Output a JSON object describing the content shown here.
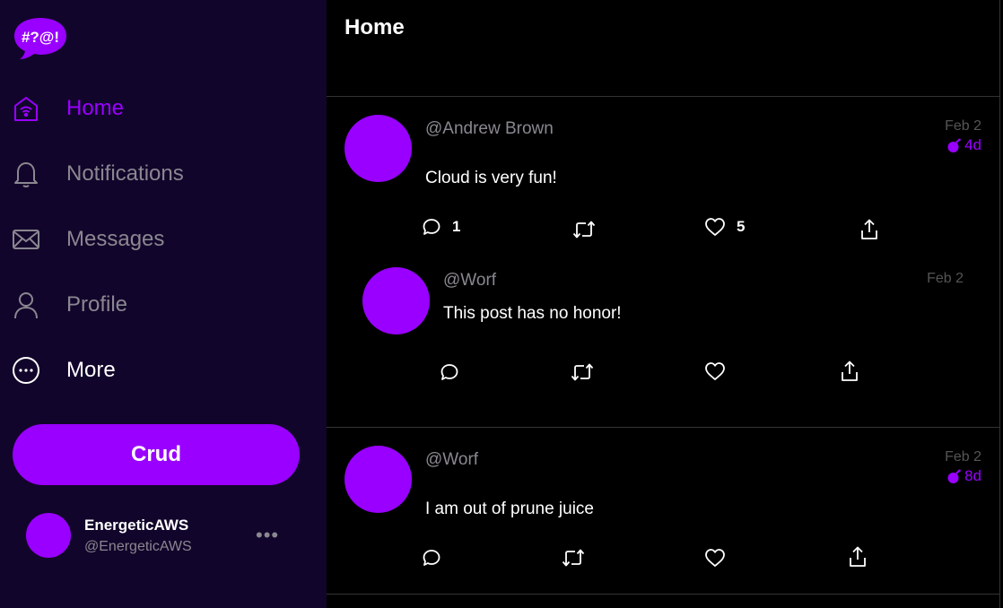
{
  "app": {
    "logo_text": "#?@!",
    "accent": "#9900ff",
    "sidebar_bg": "#12052b"
  },
  "nav": [
    {
      "label": "Home",
      "icon": "home-icon",
      "active": true
    },
    {
      "label": "Notifications",
      "icon": "bell-icon",
      "active": false
    },
    {
      "label": "Messages",
      "icon": "envelope-icon",
      "active": false
    },
    {
      "label": "Profile",
      "icon": "user-icon",
      "active": false
    },
    {
      "label": "More",
      "icon": "more-circle-icon",
      "active": false
    }
  ],
  "crud_button": {
    "label": "Crud"
  },
  "current_user": {
    "display_name": "EnergeticAWS",
    "handle": "@EnergeticAWS",
    "more": "•••"
  },
  "header": {
    "title": "Home"
  },
  "posts": [
    {
      "handle": "@Andrew Brown",
      "message": "Cloud is very fun!",
      "date": "Feb 2",
      "expires": "4d",
      "replies_count": "1",
      "likes_count": "5",
      "replies": [
        {
          "handle": "@Worf",
          "message": "This post has no honor!",
          "date": "Feb 2"
        }
      ]
    },
    {
      "handle": "@Worf",
      "message": "I am out of prune juice",
      "date": "Feb 2",
      "expires": "8d"
    }
  ]
}
